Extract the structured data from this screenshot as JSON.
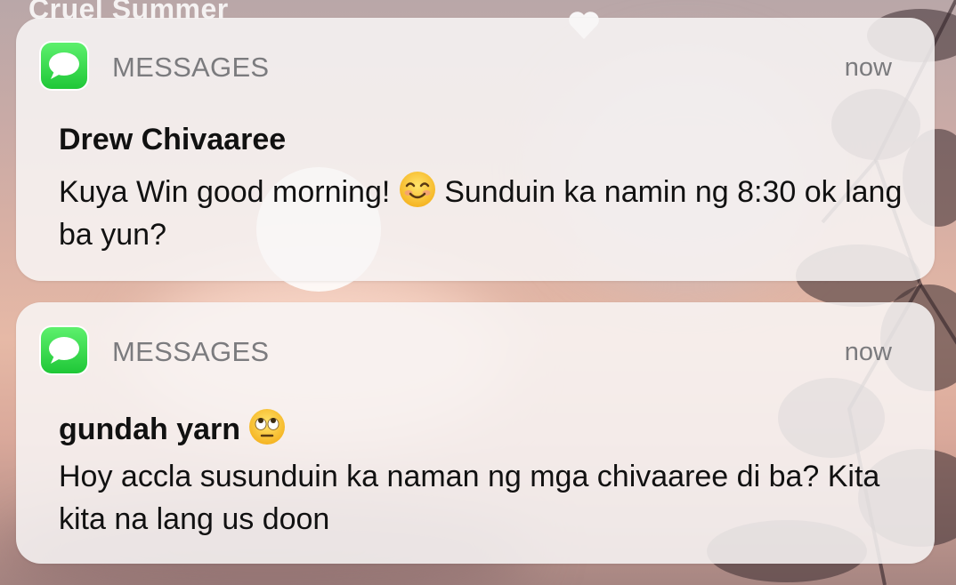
{
  "background": {
    "now_playing_title": "Cruel Summer"
  },
  "notifications": [
    {
      "app_name": "MESSAGES",
      "timestamp": "now",
      "sender": "Drew Chivaaree",
      "body_part1": "Kuya Win good morning! ",
      "body_emoji": "smiling-face-emoji",
      "body_part2": " Sunduin ka namin ng 8:30 ok lang ba yun?"
    },
    {
      "app_name": "MESSAGES",
      "timestamp": "now",
      "sender": "gundah yarn",
      "sender_emoji": "eye-roll-emoji",
      "body": "Hoy accla susunduin ka naman ng mga chivaaree di ba? Kita kita na lang us doon"
    }
  ],
  "colors": {
    "messages_green": "#2ad240",
    "card_bg": "#f8f6f6",
    "secondary_text": "#7b7b7e"
  }
}
